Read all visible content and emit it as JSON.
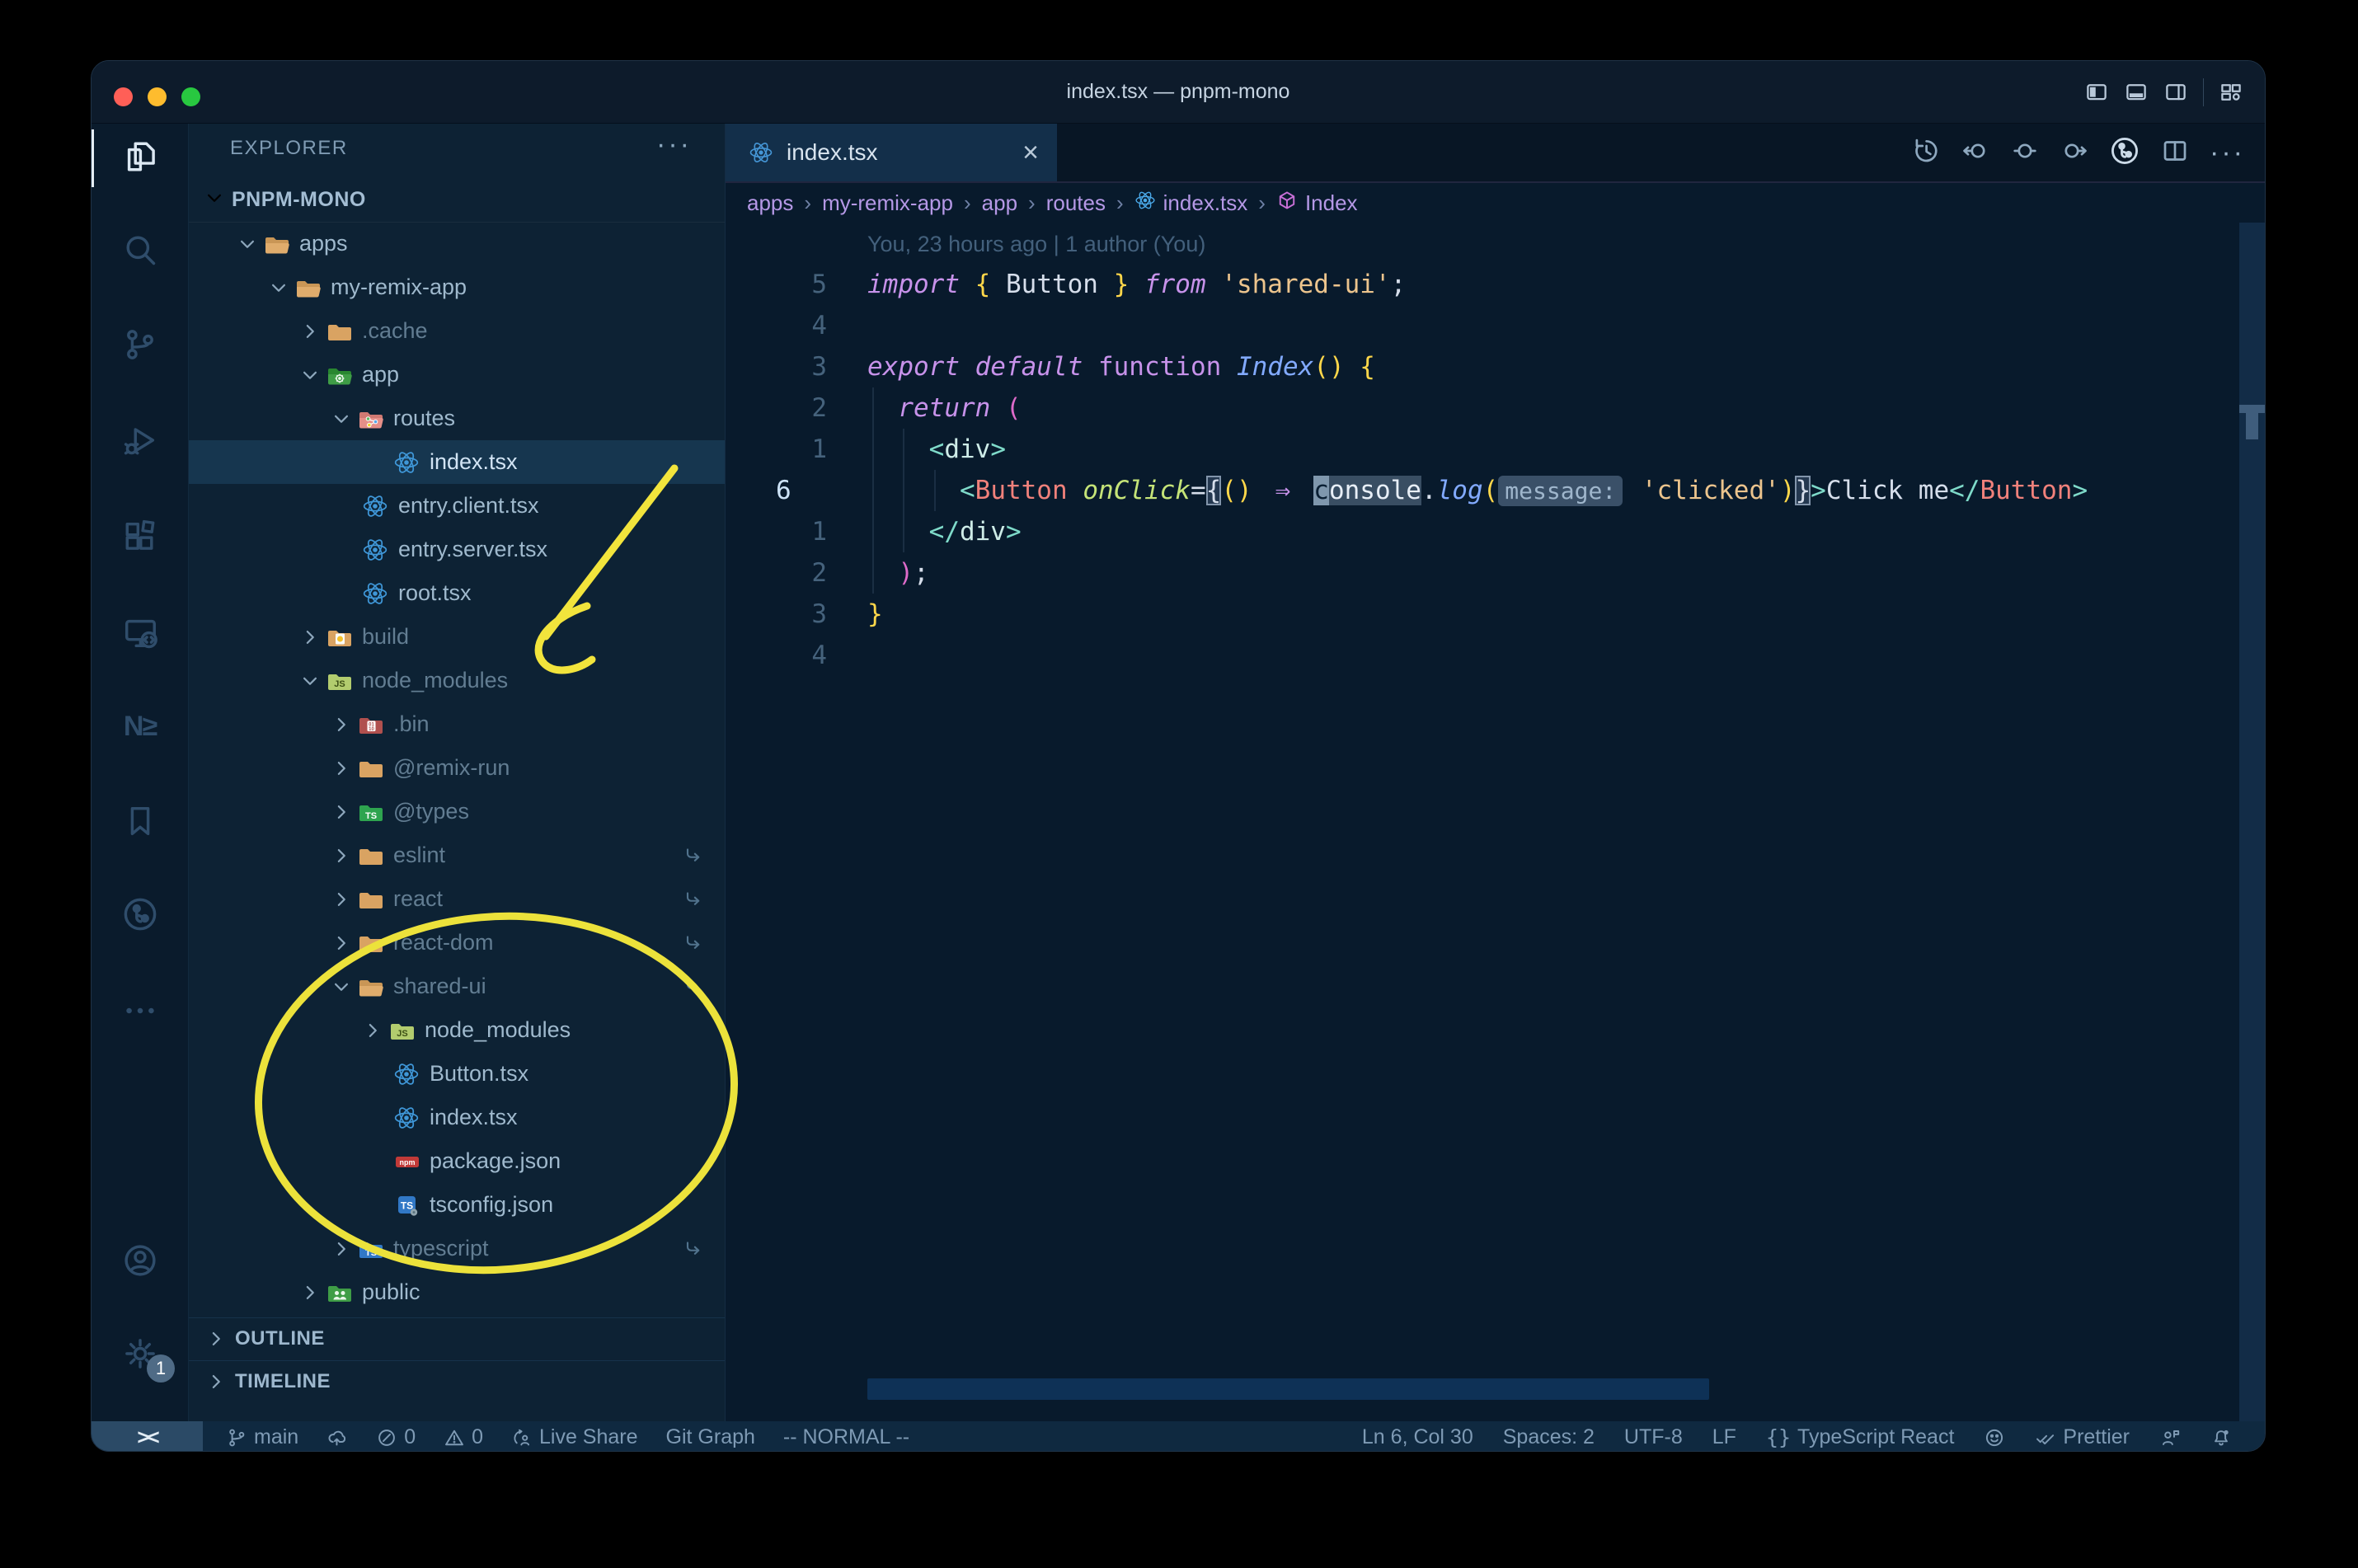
{
  "titlebar": {
    "title": "index.tsx — pnpm-mono",
    "traffic_lights": [
      "close",
      "minimize",
      "zoom"
    ],
    "layout_icons": [
      "toggle-primary-sidebar",
      "toggle-panel",
      "toggle-secondary-sidebar",
      "customize-layout"
    ]
  },
  "activity": {
    "items": [
      {
        "name": "explorer",
        "icon": "files",
        "active": true
      },
      {
        "name": "search",
        "icon": "search"
      },
      {
        "name": "source-control",
        "icon": "scm"
      },
      {
        "name": "run-and-debug",
        "icon": "debug"
      },
      {
        "name": "extensions",
        "icon": "extensions"
      },
      {
        "name": "remote-explorer",
        "icon": "remote"
      },
      {
        "name": "nx-console",
        "icon": "nx",
        "glyph": "N≥"
      },
      {
        "name": "bookmarks",
        "icon": "bookmark"
      },
      {
        "name": "git-graph",
        "icon": "gitgraph"
      },
      {
        "name": "additional-views",
        "icon": "ellipsis"
      },
      {
        "name": "accounts",
        "icon": "account"
      },
      {
        "name": "settings",
        "icon": "gear",
        "badge": "1"
      }
    ]
  },
  "explorer": {
    "header": "EXPLORER",
    "more": "···",
    "root": "PNPM-MONO",
    "tree": [
      {
        "label": "apps",
        "level": 1,
        "kind": "folder",
        "state": "open",
        "icon": "folder-tan-open"
      },
      {
        "label": "my-remix-app",
        "level": 2,
        "kind": "folder",
        "state": "open",
        "icon": "folder-tan-open"
      },
      {
        "label": ".cache",
        "level": 3,
        "kind": "folder",
        "state": "closed",
        "icon": "folder-tan",
        "dimmed": true
      },
      {
        "label": "app",
        "level": 3,
        "kind": "folder",
        "state": "open",
        "icon": "folder-app"
      },
      {
        "label": "routes",
        "level": 4,
        "kind": "folder",
        "state": "open",
        "icon": "folder-routes"
      },
      {
        "label": "index.tsx",
        "level": 5,
        "kind": "file",
        "icon": "react",
        "selected": true
      },
      {
        "label": "entry.client.tsx",
        "level": 4,
        "kind": "file",
        "icon": "react"
      },
      {
        "label": "entry.server.tsx",
        "level": 4,
        "kind": "file",
        "icon": "react"
      },
      {
        "label": "root.tsx",
        "level": 4,
        "kind": "file",
        "icon": "react"
      },
      {
        "label": "build",
        "level": 3,
        "kind": "folder",
        "state": "closed",
        "icon": "folder-build",
        "dimmed": true
      },
      {
        "label": "node_modules",
        "level": 3,
        "kind": "folder",
        "state": "open",
        "icon": "folder-nm",
        "dimmed": true
      },
      {
        "label": ".bin",
        "level": 4,
        "kind": "folder",
        "state": "closed",
        "icon": "folder-bin",
        "dimmed": true
      },
      {
        "label": "@remix-run",
        "level": 4,
        "kind": "folder",
        "state": "closed",
        "icon": "folder-tan",
        "dimmed": true
      },
      {
        "label": "@types",
        "level": 4,
        "kind": "folder",
        "state": "closed",
        "icon": "folder-types",
        "dimmed": true
      },
      {
        "label": "eslint",
        "level": 4,
        "kind": "folder",
        "state": "closed",
        "icon": "folder-tan",
        "dimmed": true,
        "symlink": true
      },
      {
        "label": "react",
        "level": 4,
        "kind": "folder",
        "state": "closed",
        "icon": "folder-tan",
        "dimmed": true,
        "symlink": true
      },
      {
        "label": "react-dom",
        "level": 4,
        "kind": "folder",
        "state": "closed",
        "icon": "folder-tan",
        "dimmed": true,
        "symlink": true
      },
      {
        "label": "shared-ui",
        "level": 4,
        "kind": "folder",
        "state": "open",
        "icon": "folder-tan-open",
        "dimmed": true,
        "symlink": true
      },
      {
        "label": "node_modules",
        "level": 5,
        "kind": "folder",
        "state": "closed",
        "icon": "folder-nm"
      },
      {
        "label": "Button.tsx",
        "level": 5,
        "kind": "file",
        "icon": "react"
      },
      {
        "label": "index.tsx",
        "level": 5,
        "kind": "file",
        "icon": "react"
      },
      {
        "label": "package.json",
        "level": 5,
        "kind": "file",
        "icon": "npm"
      },
      {
        "label": "tsconfig.json",
        "level": 5,
        "kind": "file",
        "icon": "tsconfig"
      },
      {
        "label": "typescript",
        "level": 4,
        "kind": "folder",
        "state": "closed",
        "icon": "folder-ts",
        "dimmed": true,
        "symlink": true
      },
      {
        "label": "public",
        "level": 3,
        "kind": "folder",
        "state": "closed",
        "icon": "folder-public"
      }
    ],
    "sections": [
      "OUTLINE",
      "TIMELINE"
    ]
  },
  "editor": {
    "tab": {
      "label": "index.tsx",
      "icon": "react",
      "close_glyph": "×"
    },
    "actions": [
      {
        "name": "timeline-history",
        "icon": "history"
      },
      {
        "name": "navigate-back",
        "icon": "nav-back"
      },
      {
        "name": "navigate-current",
        "icon": "nav-dot"
      },
      {
        "name": "navigate-forward",
        "icon": "nav-forward"
      },
      {
        "name": "git-graph-view",
        "icon": "gitgraph-circle"
      },
      {
        "name": "split-editor",
        "icon": "split"
      },
      {
        "name": "more-actions",
        "icon": "more",
        "glyph": "···"
      }
    ],
    "breadcrumbs": [
      {
        "label": "apps"
      },
      {
        "label": "my-remix-app"
      },
      {
        "label": "app"
      },
      {
        "label": "routes"
      },
      {
        "label": "index.tsx",
        "icon": "react"
      },
      {
        "label": "Index",
        "icon": "symbol-module"
      }
    ],
    "code_rows": [
      {
        "type": "blame",
        "text": "You, 23 hours ago | 1 author (You)"
      },
      {
        "num": "5",
        "guides": [],
        "segs": [
          [
            "kw",
            "import "
          ],
          [
            "gold",
            "{"
          ],
          [
            "id",
            " Button "
          ],
          [
            "gold",
            "}"
          ],
          [
            "kw",
            " from "
          ],
          [
            "str",
            "'shared-ui'"
          ],
          [
            "plain",
            ";"
          ]
        ]
      },
      {
        "num": "4",
        "guides": [],
        "segs": []
      },
      {
        "num": "3",
        "guides": [],
        "segs": [
          [
            "kw",
            "export default "
          ],
          [
            "kwup",
            "function "
          ],
          [
            "fn",
            "Index"
          ],
          [
            "gold",
            "()"
          ],
          [
            "plain",
            " "
          ],
          [
            "gold",
            "{"
          ]
        ]
      },
      {
        "num": "2",
        "guides": [
          0
        ],
        "segs": [
          [
            "plain",
            "  "
          ],
          [
            "kw",
            "return"
          ],
          [
            "plain",
            " "
          ],
          [
            "pink",
            "("
          ]
        ]
      },
      {
        "num": "1",
        "guides": [
          0,
          2
        ],
        "segs": [
          [
            "plain",
            "    "
          ],
          [
            "tagb",
            "<"
          ],
          [
            "tag",
            "div"
          ],
          [
            "tagb",
            ">"
          ]
        ]
      },
      {
        "num": "6",
        "current": true,
        "guides": [
          0,
          2,
          4
        ],
        "segs": [
          [
            "plain",
            "      "
          ],
          [
            "tagb",
            "<"
          ],
          [
            "comp",
            "Button"
          ],
          [
            "plain",
            " "
          ],
          [
            "attr",
            "onClick"
          ],
          [
            "plain",
            "="
          ],
          [
            "box",
            "{"
          ],
          [
            "gold",
            "()"
          ],
          [
            "plain",
            " "
          ],
          [
            "arrow",
            "⇒"
          ],
          [
            "plain",
            " "
          ],
          [
            "cursor",
            "c"
          ],
          [
            "hl",
            "onsole"
          ],
          [
            "plain",
            "."
          ],
          [
            "fn",
            "log"
          ],
          [
            "gold",
            "("
          ],
          [
            "inlay",
            "message:"
          ],
          [
            "plain",
            " "
          ],
          [
            "str",
            "'clicked'"
          ],
          [
            "gold",
            ")"
          ],
          [
            "box",
            "}"
          ],
          [
            "tagb",
            ">"
          ],
          [
            "id",
            "Click me"
          ],
          [
            "tagb",
            "</"
          ],
          [
            "comp",
            "Button"
          ],
          [
            "tagb",
            ">"
          ]
        ]
      },
      {
        "num": "1",
        "guides": [
          0,
          2
        ],
        "segs": [
          [
            "plain",
            "    "
          ],
          [
            "tagb",
            "</"
          ],
          [
            "tag",
            "div"
          ],
          [
            "tagb",
            ">"
          ]
        ]
      },
      {
        "num": "2",
        "guides": [
          0
        ],
        "segs": [
          [
            "plain",
            "  "
          ],
          [
            "pink",
            ")"
          ],
          [
            "plain",
            ";"
          ]
        ]
      },
      {
        "num": "3",
        "guides": [],
        "segs": [
          [
            "gold",
            "}"
          ]
        ]
      },
      {
        "num": "4",
        "guides": [],
        "segs": []
      }
    ]
  },
  "status": {
    "left": [
      {
        "name": "remote-indicator",
        "icon": "remote-glyph",
        "text": "><"
      },
      {
        "name": "git-branch",
        "icon": "branch",
        "text": "main"
      },
      {
        "name": "publish-sync",
        "icon": "cloud-upload",
        "text": ""
      },
      {
        "name": "errors",
        "icon": "error",
        "text": "0"
      },
      {
        "name": "warnings",
        "icon": "warning",
        "text": "0"
      },
      {
        "name": "live-share",
        "icon": "liveshare",
        "text": "Live Share"
      },
      {
        "name": "git-graph-status",
        "text": "Git Graph"
      },
      {
        "name": "vim-mode",
        "text": "-- NORMAL --"
      }
    ],
    "right": [
      {
        "name": "cursor-position",
        "text": "Ln 6, Col 30"
      },
      {
        "name": "indentation",
        "text": "Spaces: 2"
      },
      {
        "name": "encoding",
        "text": "UTF-8"
      },
      {
        "name": "eol",
        "text": "LF"
      },
      {
        "name": "language-mode",
        "icon": "braces",
        "text": "TypeScript React"
      },
      {
        "name": "feedback-smiley",
        "icon": "smiley",
        "text": ""
      },
      {
        "name": "prettier",
        "icon": "double-check",
        "text": "Prettier"
      },
      {
        "name": "live-share-contact",
        "icon": "person-feedback",
        "text": ""
      },
      {
        "name": "notifications",
        "icon": "bell-dot",
        "text": ""
      }
    ]
  },
  "annotations": {
    "arrow_color": "#f2e43c",
    "ellipse_color": "#ece23b",
    "targets": [
      "node_modules",
      "shared-ui package contents"
    ]
  },
  "colors": {
    "traffic_close": "#ff5f57",
    "traffic_min": "#febc2e",
    "traffic_zoom": "#28c840",
    "editor_bg": "#081a2c",
    "sidebar_bg": "#0d2234",
    "statusbar_bg": "#0f2940",
    "selection_row": "#16364f",
    "react_icon_blue": "#3f97d8",
    "breadcrumb_purple": "#b598e6"
  }
}
